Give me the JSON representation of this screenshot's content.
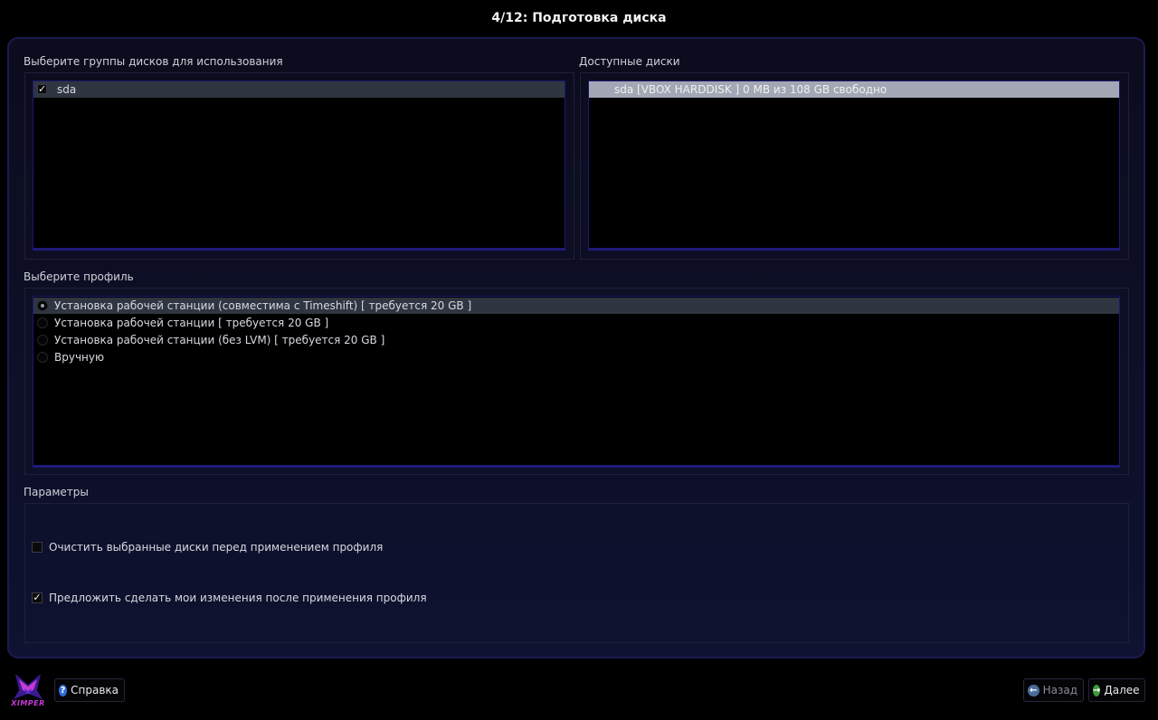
{
  "window": {
    "title": "4/12: Подготовка диска"
  },
  "disk_groups": {
    "label": "Выберите группы дисков для использования",
    "items": [
      {
        "label": "sda",
        "checked": true
      }
    ]
  },
  "available_disks": {
    "label": "Доступные диски",
    "items": [
      {
        "label": "sda [VBOX HARDDISK   ]  0 MB из 108 GB свободно"
      }
    ]
  },
  "profile": {
    "label": "Выберите профиль",
    "options": [
      {
        "label": "Установка рабочей станции (совместима с Timeshift) [ требуется 20 GB ]",
        "selected": true
      },
      {
        "label": "Установка рабочей станции [ требуется 20 GB ]",
        "selected": false
      },
      {
        "label": "Установка рабочей станции (без LVM) [ требуется 20 GB ]",
        "selected": false
      },
      {
        "label": "Вручную",
        "selected": false
      }
    ]
  },
  "params": {
    "label": "Параметры",
    "wipe": {
      "label": "Очистить выбранные диски перед применением профиля",
      "checked": false
    },
    "suggest": {
      "label": "Предложить сделать мои изменения после применения профиля",
      "checked": true
    }
  },
  "footer": {
    "logo_text": "XIMPER",
    "help_label": "Справка",
    "back_label": "Назад",
    "next_label": "Далее"
  },
  "colors": {
    "accent": "#1b1a52",
    "help_icon": "#2f6fd6",
    "back_icon": "#4a6d9a",
    "next_icon": "#3c9a3c",
    "logo": "#c43bd6"
  }
}
